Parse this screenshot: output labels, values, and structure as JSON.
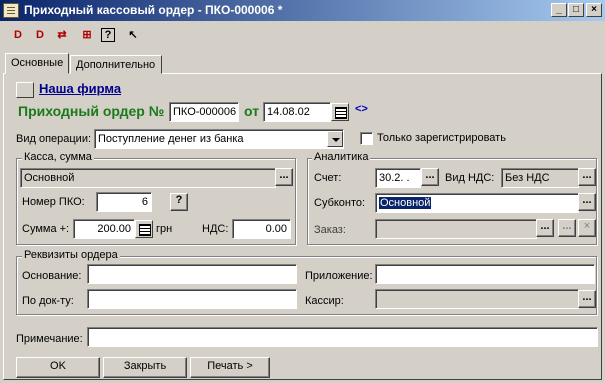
{
  "window": {
    "title": "Приходный кассовый ордер - ПКО-000006 *",
    "min_glyph": "_",
    "max_glyph": "□",
    "close_glyph": "×"
  },
  "toolbar": {
    "items": [
      "copy-document-icon",
      "delete-document-icon",
      "post-document-icon",
      "structure-icon",
      "help-icon",
      "actions-icon"
    ],
    "glyphs": [
      "D",
      "D",
      "⇄",
      "⊞",
      "?",
      "↖"
    ]
  },
  "tabs": [
    {
      "label": "Основные",
      "active": true
    },
    {
      "label": "Дополнительно",
      "active": false
    }
  ],
  "header": {
    "firm_link": "Наша фирма",
    "order_label": "Приходный ордер №",
    "order_number": "ПКО-000006",
    "date_label": "от",
    "date": "14.08.02",
    "swap_glyph": "<>"
  },
  "operation": {
    "label": "Вид операции:",
    "value": "Поступление денег из банка",
    "only_registered_label": "Только зарегистрировать",
    "only_registered_checked": false
  },
  "cash_group": {
    "title": "Касса, сумма",
    "cashbox": "Основной",
    "pko_number_label": "Номер ПКО:",
    "pko_number": "6",
    "help_glyph": "?",
    "sum_label": "Сумма +:",
    "sum": "200.00",
    "currency": "грн",
    "vat_label": "НДС:",
    "vat": "0.00"
  },
  "analytics_group": {
    "title": "Аналитика",
    "account_label": "Счет:",
    "account": "30.2. .",
    "vat_type_label": "Вид НДС:",
    "vat_type": "Без НДС",
    "subconto_label": "Субконто:",
    "subconto": "Основной",
    "order_label": "Заказ:",
    "order": ""
  },
  "requisites_group": {
    "title": "Реквизиты ордера",
    "basis_label": "Основание:",
    "basis": "",
    "attachment_label": "Приложение:",
    "attachment": "",
    "by_doc_label": "По док-ту:",
    "by_doc": "",
    "cashier_label": "Кассир:",
    "cashier": ""
  },
  "note": {
    "label": "Примечание:",
    "value": ""
  },
  "buttons": {
    "ok": "OK",
    "close": "Закрыть",
    "print": "Печать >"
  },
  "colors": {
    "title_start": "#0a246a",
    "title_end": "#a6caf0",
    "order_green": "#1a7a1a",
    "link_blue": "#00008b",
    "face": "#d4d0c8"
  }
}
